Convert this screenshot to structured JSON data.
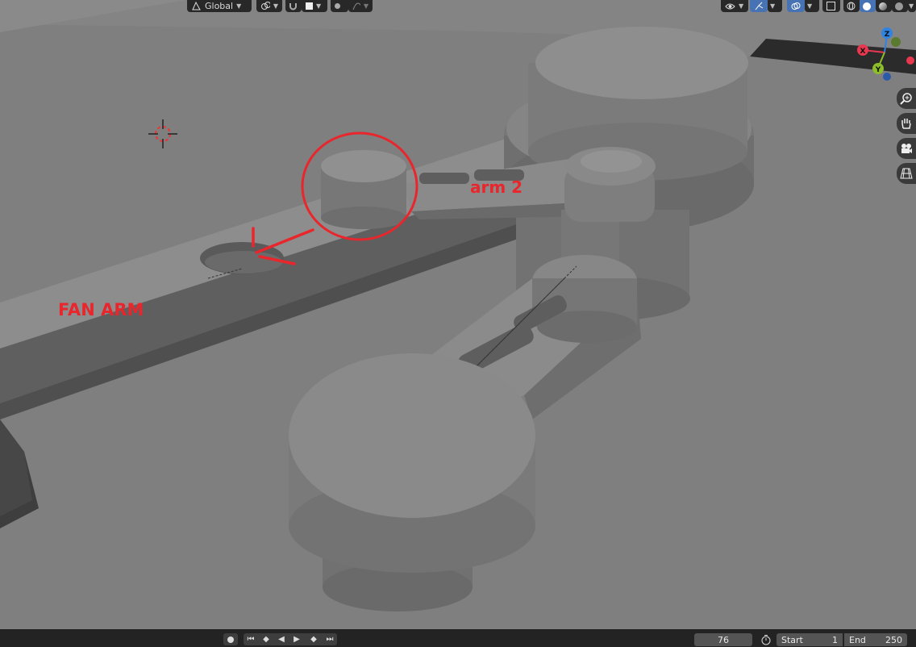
{
  "header": {
    "orientation_label": "Global",
    "orientation_icon": "transform-orientation-icon",
    "pivot_icon": "pivot-point-icon",
    "snap_icon": "snap-magnet-icon",
    "proportional_icon": "proportional-editing-icon"
  },
  "right_header": {
    "icons": [
      "visibility-icon",
      "gizmo-icon",
      "overlay-icon",
      "xray-icon",
      "wireframe-shading-icon",
      "solid-shading-icon",
      "material-shading-icon",
      "rendered-shading-icon"
    ],
    "active_shading": "solid-shading-icon"
  },
  "gizmo": {
    "z_label": "Z",
    "x_label": "X",
    "y_label": "Y",
    "colors": {
      "x": "#e8384f",
      "y": "#8cbd2a",
      "z": "#2f83e3"
    }
  },
  "nav_buttons": [
    "zoom-icon",
    "pan-hand-icon",
    "camera-icon",
    "grid-view-icon"
  ],
  "annotations": {
    "arm2_label": "arm 2",
    "fan_arm_label": "FAN ARM",
    "color": "#e8262c"
  },
  "timeline": {
    "current_frame": "76",
    "start_label": "Start",
    "start_value": "1",
    "end_label": "End",
    "end_value": "250"
  }
}
